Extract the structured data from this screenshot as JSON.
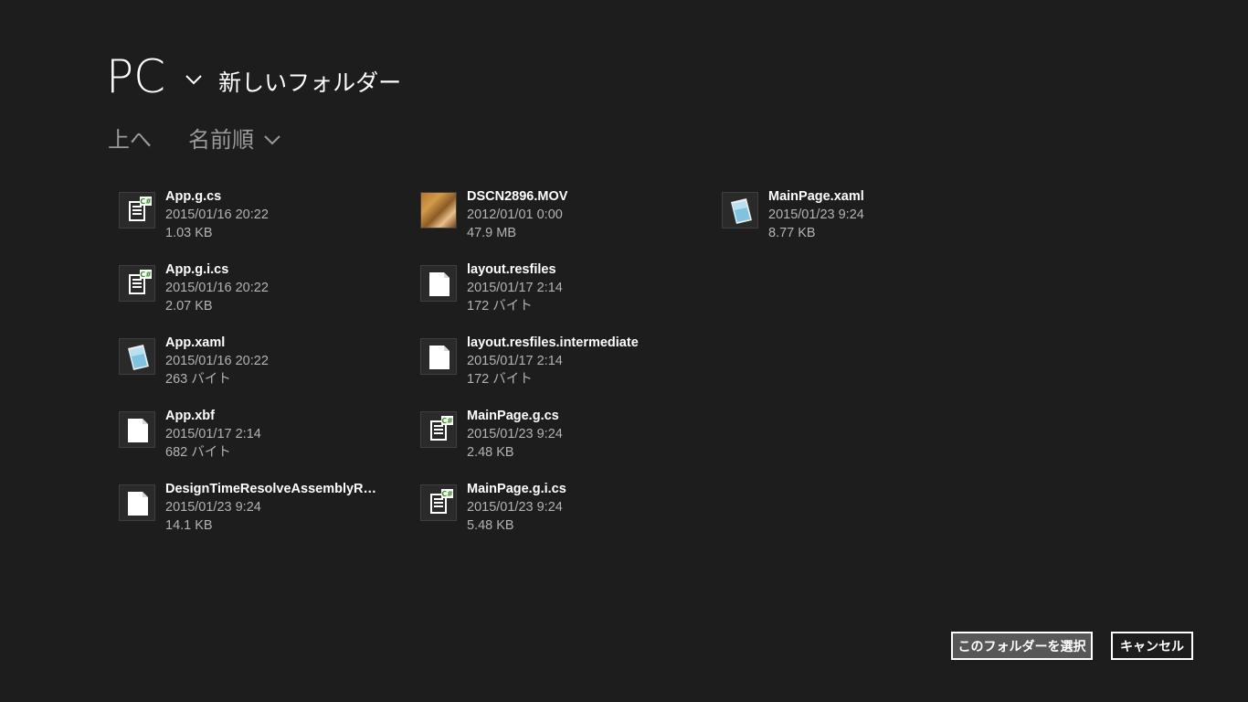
{
  "header": {
    "location": "PC",
    "folder_name": "新しいフォルダー"
  },
  "subnav": {
    "up_label": "上へ",
    "sort_label": "名前順"
  },
  "files": [
    {
      "name": "App.g.cs",
      "date": "2015/01/16 20:22",
      "size": "1.03 KB",
      "icon": "csharp-file-icon"
    },
    {
      "name": "App.g.i.cs",
      "date": "2015/01/16 20:22",
      "size": "2.07 KB",
      "icon": "csharp-file-icon"
    },
    {
      "name": "App.xaml",
      "date": "2015/01/16 20:22",
      "size": "263 バイト",
      "icon": "xaml-file-icon"
    },
    {
      "name": "App.xbf",
      "date": "2015/01/17 2:14",
      "size": "682 バイト",
      "icon": "blank-file-icon"
    },
    {
      "name": "DesignTimeResolveAssemblyR…",
      "date": "2015/01/23 9:24",
      "size": "14.1 KB",
      "icon": "blank-file-icon"
    },
    {
      "name": "DSCN2896.MOV",
      "date": "2012/01/01 0:00",
      "size": "47.9 MB",
      "icon": "video-thumbnail"
    },
    {
      "name": "layout.resfiles",
      "date": "2015/01/17 2:14",
      "size": "172 バイト",
      "icon": "blank-file-icon"
    },
    {
      "name": "layout.resfiles.intermediate",
      "date": "2015/01/17 2:14",
      "size": "172 バイト",
      "icon": "blank-file-icon"
    },
    {
      "name": "MainPage.g.cs",
      "date": "2015/01/23 9:24",
      "size": "2.48 KB",
      "icon": "csharp-file-icon"
    },
    {
      "name": "MainPage.g.i.cs",
      "date": "2015/01/23 9:24",
      "size": "5.48 KB",
      "icon": "csharp-file-icon"
    },
    {
      "name": "MainPage.xaml",
      "date": "2015/01/23 9:24",
      "size": "8.77 KB",
      "icon": "xaml-file-icon"
    }
  ],
  "buttons": {
    "select_label": "このフォルダーを選択",
    "cancel_label": "キャンセル"
  },
  "colors": {
    "background": "#1d1d1d",
    "text": "#ffffff",
    "secondary_text": "#b3b3b3",
    "nav_text": "#9a9a9a",
    "primary_button": "#575757"
  }
}
